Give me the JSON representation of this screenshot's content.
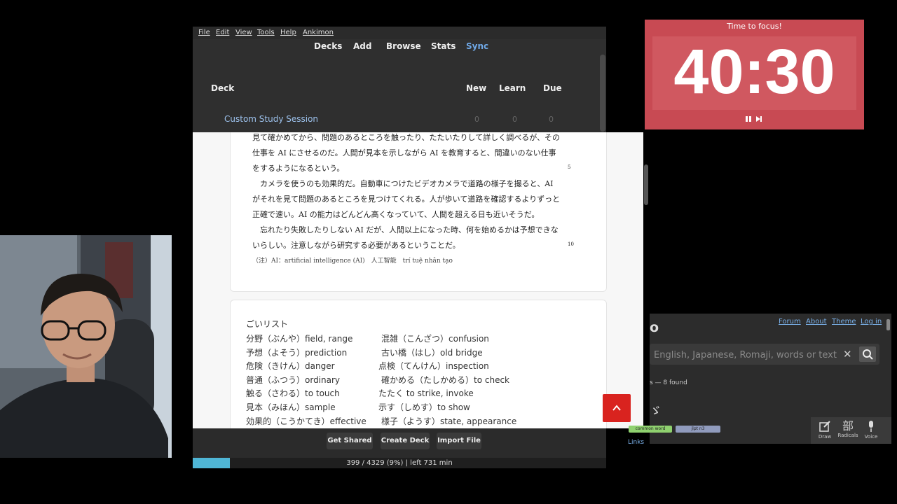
{
  "anki": {
    "menu": [
      "File",
      "Edit",
      "View",
      "Tools",
      "Help",
      "Ankimon"
    ],
    "toolbar": [
      "Decks",
      "Add",
      "Browse",
      "Stats",
      "Sync"
    ],
    "headers": {
      "deck": "Deck",
      "new": "New",
      "learn": "Learn",
      "due": "Due"
    },
    "decks": [
      {
        "name": "Custom Study Session",
        "new": "0",
        "learn": "0",
        "due": "0"
      }
    ],
    "buttons": {
      "get_shared": "Get Shared",
      "create_deck": "Create Deck",
      "import_file": "Import File"
    },
    "progress": {
      "text": "399 / 4329 (9%) | left 731 min",
      "fraction": 0.09
    },
    "accent": "#4fb6d6"
  },
  "reading": {
    "lines": [
      "見て確かめてから、問題のあるところを触ったり、たたいたりして詳しく調べるが、その",
      "仕事を AI にさせるのだ。人間が見本を示しながら AI を教育すると、間違いのない仕事",
      "をするようになるという。",
      "　カメラを使うのも効果的だ。自動車につけたビデオカメラで道路の様子を撮ると、AI",
      "がそれを見て問題のあるところを見つけてくれる。人が歩いて道路を確認するよりずっと",
      "正確で速い。AI の能力はどんどん高くなっていて、人間を超える日も近いそうだ。",
      "　忘れたり失敗したりしない AI だが、人間以上になった時、何を始めるかは予想できな",
      "いらしい。注意しながら研究する必要があるということだ。"
    ],
    "line_numbers": [
      "5",
      "10"
    ],
    "note": "（注）AI：artificial intelligence (AI)　人工智能　trí tuệ nhân tạo"
  },
  "vocab": {
    "title": "ごいリスト",
    "left": [
      "分野（ぶんや）field, range",
      "予想（よそう）prediction",
      "危険（きけん）danger",
      "普通（ふつう）ordinary",
      "触る（さわる）to touch",
      "見本（みほん）sample",
      "効果的（こうかてき）effective"
    ],
    "right": [
      "混雑（こんざつ）confusion",
      "古い橋（はし）old bridge",
      "点検（てんけん）inspection",
      "確かめる（たしかめる）to check",
      "たたく to strike, invoke",
      "示す（しめす）to show",
      "様子（ようす）state, appearance"
    ]
  },
  "timer": {
    "label": "Time to focus!",
    "value": "40:30",
    "controls": "❚❚ ▶❙"
  },
  "dict": {
    "logo": "o",
    "links": [
      "Forum",
      "About",
      "Theme",
      "Log in"
    ],
    "placeholder": "English, Japanese, Romaji, words or text",
    "found": "s — 8 found",
    "kana": "ゞ",
    "tags": [
      "common word",
      "jlpt n3"
    ],
    "links_label": "Links",
    "tools": [
      "Draw",
      "Radicals",
      "Voice"
    ]
  },
  "colors": {
    "timer_bg": "#c84a53",
    "top_button": "#d9231f"
  }
}
